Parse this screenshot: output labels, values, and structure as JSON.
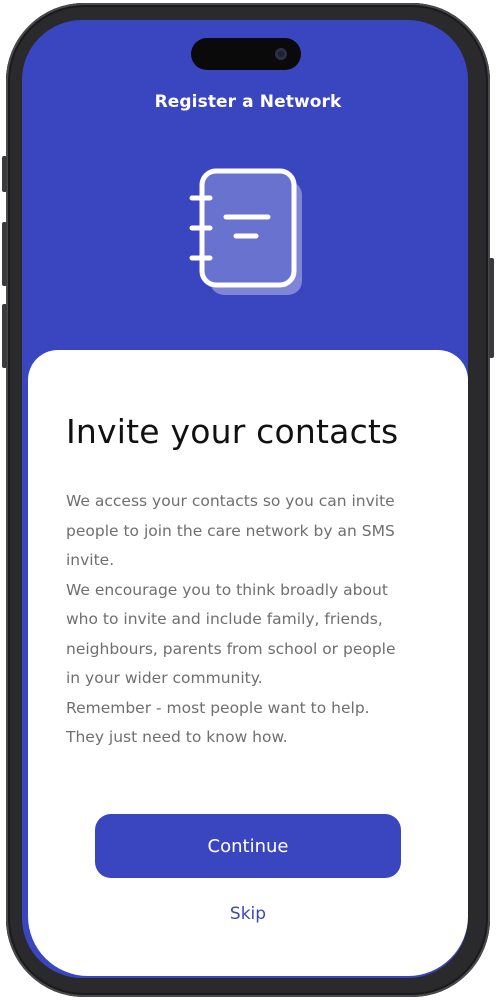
{
  "header": {
    "title": "Register a Network",
    "icon": "notebook-icon"
  },
  "main": {
    "title": "Invite your contacts",
    "paragraphs": [
      "We access your contacts so you can invite",
      "people to join the care network by an SMS",
      "invite.",
      "We encourage you to think broadly about",
      "who to invite and include family, friends,",
      "neighbours, parents from school or people",
      "in your wider community.",
      "Remember - most people want to help.",
      "They just need to know how."
    ]
  },
  "actions": {
    "continue_label": "Continue",
    "skip_label": "Skip"
  },
  "colors": {
    "brand": "#3a46bf",
    "body_text": "#6f6f6f",
    "title_text": "#111111"
  }
}
